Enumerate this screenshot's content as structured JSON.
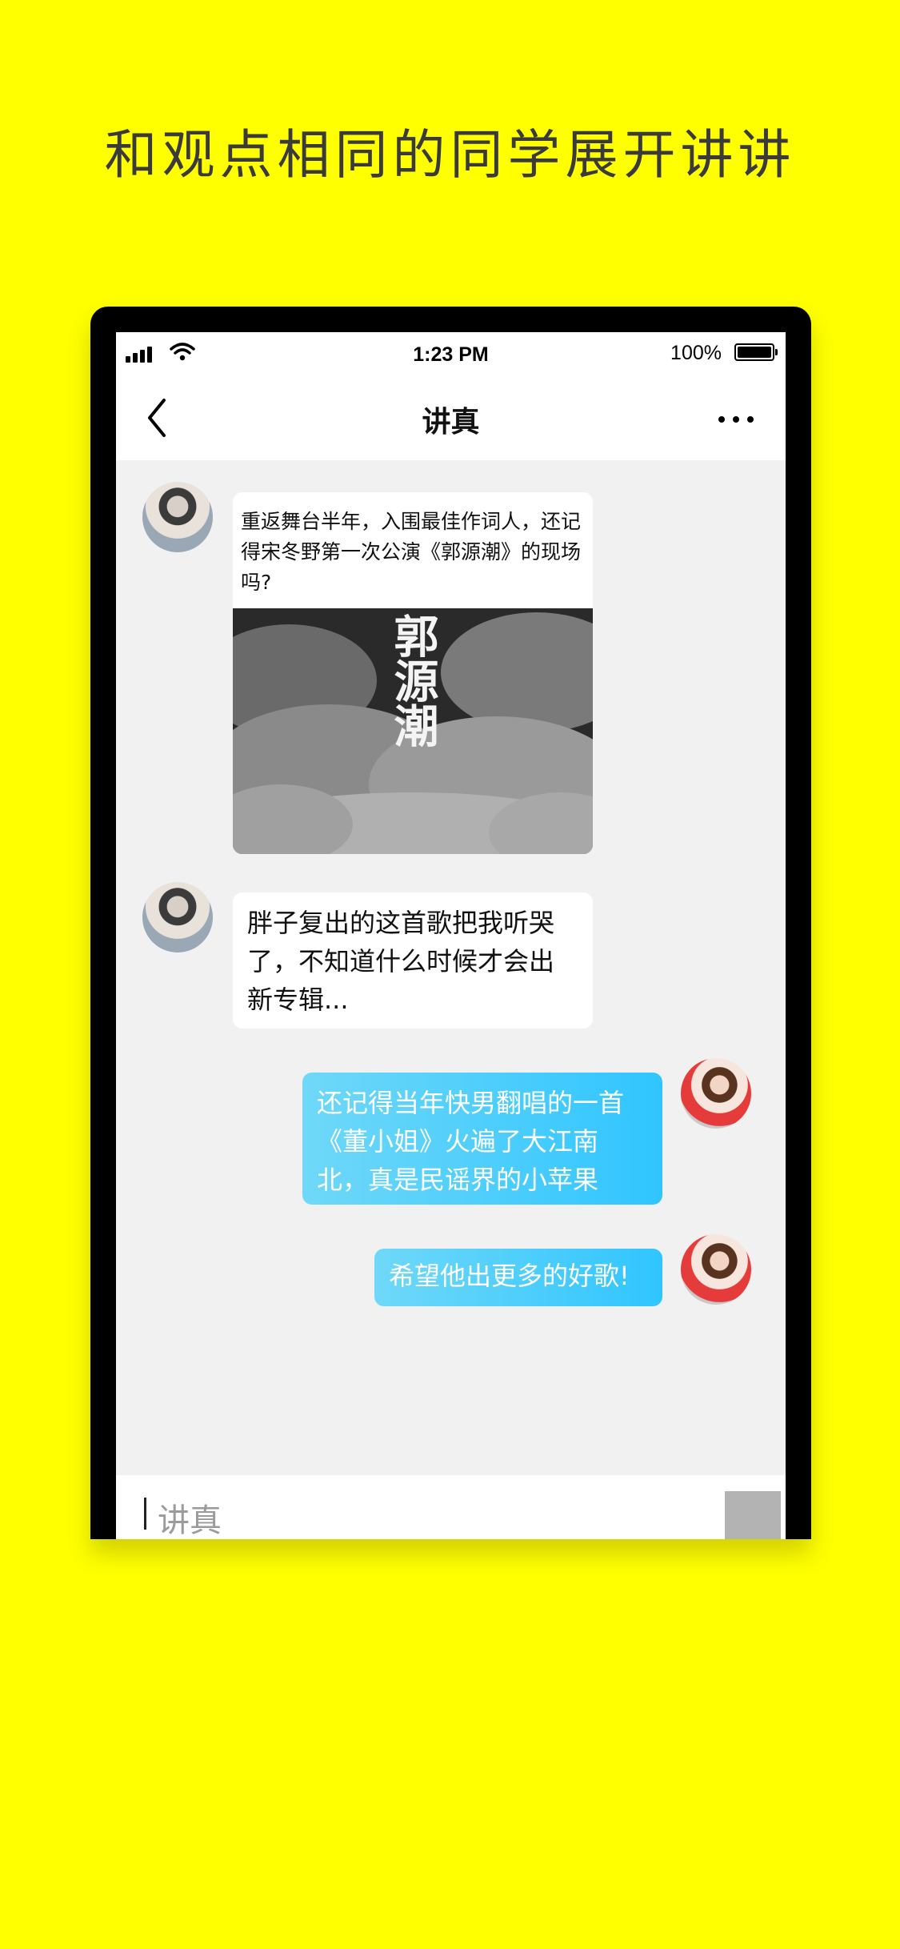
{
  "headline": "和观点相同的同学展开讲讲",
  "status_bar": {
    "time": "1:23 PM",
    "battery": "100%"
  },
  "nav": {
    "title": "讲真"
  },
  "messages": [
    {
      "side": "left",
      "type": "card",
      "text": "重返舞台半年，入围最佳作词人，还记得宋冬野第一次公演《郭源潮》的现场吗?",
      "image_text": "郭源潮"
    },
    {
      "side": "left",
      "type": "text",
      "text": "胖子复出的这首歌把我听哭\n了，不知道什么时候才会出\n新专辑..."
    },
    {
      "side": "right",
      "type": "text",
      "text": "还记得当年快男翻唱的一首\n《董小姐》火遍了大江南\n北，真是民谣界的小苹果"
    },
    {
      "side": "right",
      "type": "text",
      "text": "希望他出更多的好歌!"
    }
  ],
  "input": {
    "placeholder": "讲真"
  },
  "colors": {
    "background": "#FFFF00",
    "right_bubble_start": "#6FD8F8",
    "right_bubble_end": "#30C5FF",
    "chat_bg": "#F1F1F1"
  }
}
